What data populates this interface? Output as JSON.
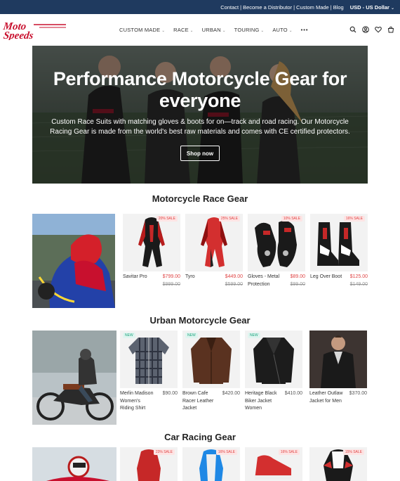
{
  "topbar": {
    "links": [
      "Contact",
      "Become a Distributor",
      "Custom Made",
      "Blog"
    ],
    "separator": "|",
    "currency": "USD - US Dollar"
  },
  "header": {
    "logo_text": "Moto Speeds",
    "nav": [
      {
        "label": "CUSTOM MADE"
      },
      {
        "label": "RACE"
      },
      {
        "label": "URBAN"
      },
      {
        "label": "TOURING"
      },
      {
        "label": "AUTO"
      }
    ],
    "more": "•••",
    "icons": [
      "search-icon",
      "account-icon",
      "wishlist-icon",
      "cart-icon"
    ]
  },
  "hero": {
    "title": "Performance Motorcycle Gear for everyone",
    "text": "Custom Race Suits with matching gloves & boots for on—track and road racing. Our Motorcycle Racing Gear is made from the world's best raw materials and comes with CE certified protectors.",
    "button": "Shop now"
  },
  "race": {
    "title": "Motorcycle Race Gear",
    "products": [
      {
        "badge": "20% SALE",
        "name": "Savitar Pro",
        "price": "$799.00",
        "old": "$999.00"
      },
      {
        "badge": "25% SALE",
        "name": "Tyro",
        "price": "$449.00",
        "old": "$599.00"
      },
      {
        "badge": "10% SALE",
        "name": "Gloves - Metal Protection",
        "price": "$89.00",
        "old": "$99.00"
      },
      {
        "badge": "16% SALE",
        "name": "Leg Over Boot",
        "price": "$125.00",
        "old": "$149.00"
      }
    ]
  },
  "urban": {
    "title": "Urban Motorcycle Gear",
    "products": [
      {
        "badge": "NEW",
        "name": "Merlin Madison Women's Riding Shirt",
        "price": "$90.00"
      },
      {
        "badge": "NEW",
        "name": "Brown Cafe Racer Leather Jacket",
        "price": "$420.00"
      },
      {
        "badge": "NEW",
        "name": "Heritage Black Biker Jacket Women",
        "price": "$410.00"
      },
      {
        "badge": "",
        "name": "Leather Outlaw Jacket for Men",
        "price": "$370.00"
      }
    ]
  },
  "car": {
    "title": "Car Racing Gear",
    "badges": [
      "23% SALE",
      "16% SALE",
      "16% SALE",
      "15% SALE"
    ]
  },
  "colors": {
    "topbar": "#1f3a5f",
    "brand_red": "#c8102e",
    "sale": "#e04545",
    "new": "#1ba37c"
  }
}
